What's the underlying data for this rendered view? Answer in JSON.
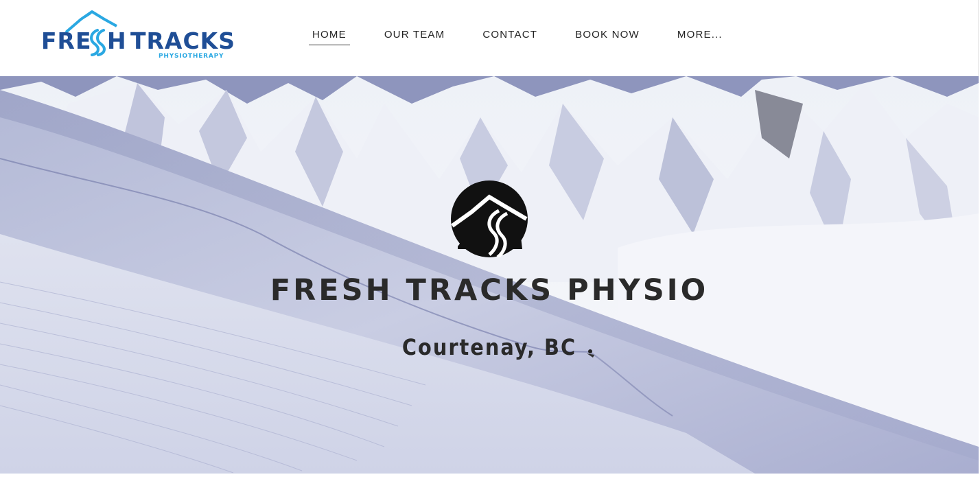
{
  "brand": {
    "logo_word_left": "FRE",
    "logo_word_mid": "H",
    "logo_word_right": "TRACKS",
    "logo_tagline": "PHYSIOTHERAPY",
    "primary_color": "#1f4e96",
    "accent_color": "#2aa8e2"
  },
  "nav": {
    "items": [
      {
        "label": "HOME",
        "active": true
      },
      {
        "label": "OUR TEAM",
        "active": false
      },
      {
        "label": "CONTACT",
        "active": false
      },
      {
        "label": "BOOK NOW",
        "active": false
      },
      {
        "label": "MORE...",
        "active": false
      }
    ]
  },
  "hero": {
    "title": "FRESH TRACKS PHYSIO",
    "subtitle": "Courtenay, BC",
    "emblem_icon": "mountain-ski-tracks-icon",
    "background": "snowy-mountain-slope-with-skier"
  }
}
